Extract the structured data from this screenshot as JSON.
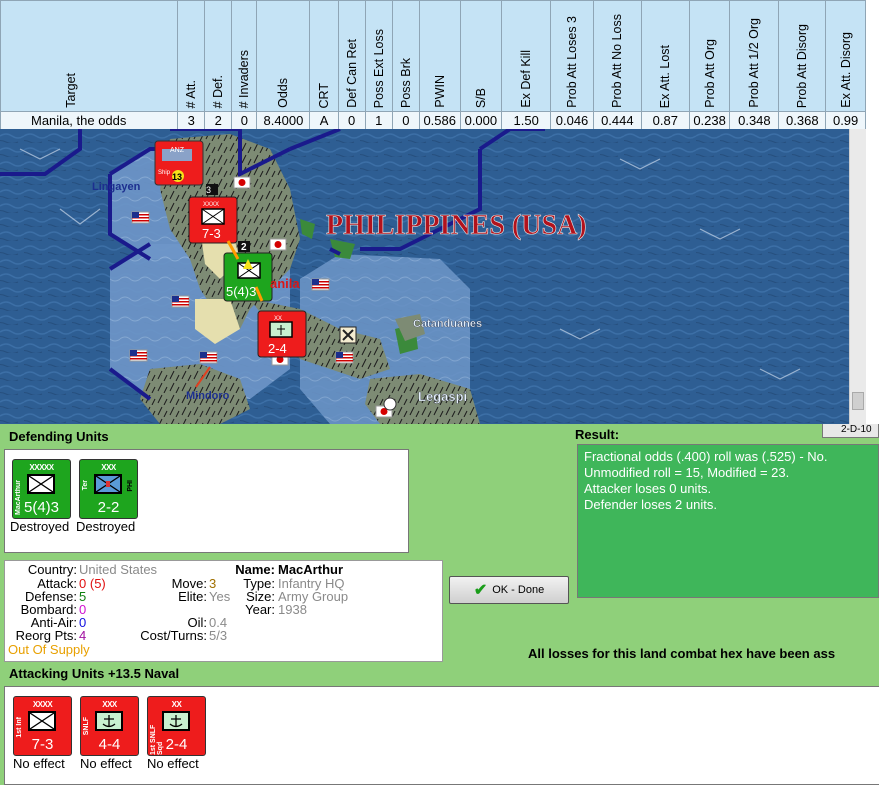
{
  "odds_table": {
    "headers": [
      "Target",
      "# Att.",
      "# Def.",
      "# Invaders",
      "Odds",
      "CRT",
      "Def Can Ret",
      "Poss Ext Loss",
      "Poss Brk",
      "PWIN",
      "S/B",
      "Ex Def Kill",
      "Prob Att Loses 3",
      "Prob Att No Loss",
      "Ex Att. Lost",
      "Prob Att Org",
      "Prob Att 1/2 Org",
      "Prob Att Disorg",
      "Ex Att. Disorg"
    ],
    "row": [
      "Manila, the odds",
      "3",
      "2",
      "0",
      "8.4000",
      "A",
      "0",
      "1",
      "0",
      "0.586",
      "0.000",
      "1.50",
      "0.046",
      "0.444",
      "0.87",
      "0.238",
      "0.348",
      "0.368",
      "0.99"
    ]
  },
  "map": {
    "title": "PHILIPPINES (USA)",
    "labels": {
      "lingayen": "Lingayen",
      "manila": "anila",
      "catanduanes": "Catanduanes",
      "legaspi": "Legaspi",
      "mindoro": "Mindoro"
    },
    "counters": [
      {
        "type": "naval",
        "top": "ANZ",
        "mid": "Ship",
        "num": "13"
      },
      {
        "size": "XXXX",
        "strength": "7-3"
      },
      {
        "size": "XXXXX",
        "strength": "5(4)3",
        "side": "MacArthur"
      },
      {
        "size": "XX",
        "strength": "2-4"
      }
    ],
    "stack_counts": [
      "3",
      "2"
    ]
  },
  "colors": {
    "sea": "#2e5e93",
    "land": "#8a9a7a",
    "panel_green": "#8fd07a",
    "result_green": "#3fb65a",
    "german_red": "#ee1c1c",
    "allied_green": "#1ea51e",
    "hex_line": "#1a1a8c"
  },
  "defending": {
    "heading": "Defending Units",
    "units": [
      {
        "size": "XXXXX",
        "side": "MacArthur",
        "strength": "5(4)3",
        "status": "Destroyed"
      },
      {
        "size": "XXX",
        "side": "Ter",
        "side_right": "PHI",
        "strength": "2-2",
        "status": "Destroyed"
      }
    ]
  },
  "unit_info": {
    "country_label": "Country:",
    "country": "United States",
    "attack_label": "Attack:",
    "attack": "0",
    "attack_paren": "(5)",
    "defense_label": "Defense:",
    "defense": "5",
    "bombard_label": "Bombard:",
    "bombard": "0",
    "antiair_label": "Anti-Air:",
    "antiair": "0",
    "reorg_label": "Reorg Pts:",
    "reorg": "4",
    "supply": "Out Of Supply",
    "move_label": "Move:",
    "move": "3",
    "elite_label": "Elite:",
    "elite": "Yes",
    "oil_label": "Oil:",
    "oil": "0.4",
    "cost_label": "Cost/Turns:",
    "cost": "5/3",
    "name_label": "Name:",
    "name": "MacArthur",
    "type_label": "Type:",
    "type": "Infantry HQ",
    "size_label": "Size:",
    "size": "Army Group",
    "year_label": "Year:",
    "year": "1938"
  },
  "result": {
    "heading": "Result:",
    "lines": [
      "Fractional odds (.400) roll was (.525)  - No.",
      "Unmodified roll = 15, Modified = 23.",
      "Attacker loses 0 units.",
      "Defender loses 2 units."
    ]
  },
  "ok_button": {
    "label": "OK - Done",
    "icon": "check-icon"
  },
  "tab_partial": "2-D-10",
  "losses_message": "All losses for this land combat hex have been ass",
  "attacking": {
    "heading": "Attacking Units +13.5 Naval",
    "units": [
      {
        "size": "XXXX",
        "side": "1st Inf",
        "strength": "7-3",
        "status": "No effect"
      },
      {
        "size": "XXX",
        "side": "SNLF",
        "strength": "4-4",
        "status": "No effect"
      },
      {
        "size": "XX",
        "side": "1st SNLF Sqd",
        "strength": "2-4",
        "status": "No effect"
      }
    ]
  }
}
